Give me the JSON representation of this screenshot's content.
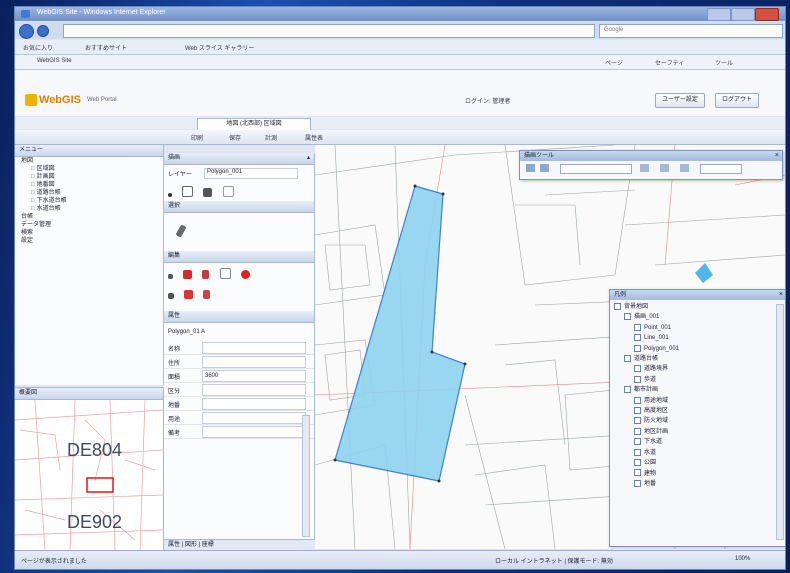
{
  "browser": {
    "title": "WebGIS Site - Windows Internet Explorer",
    "search_placeholder": "Google"
  },
  "favorites": [
    "お気に入り",
    "おすすめサイト",
    "Web スライス ギャラリー"
  ],
  "command": [
    "ページ",
    "セーフティ",
    "ツール"
  ],
  "tab_label": "WebGIS Site",
  "app": {
    "logo": "WebGIS",
    "logo_sub": "Web Portal",
    "user_info": "ログイン: 管理者",
    "buttons": [
      "ユーザー設定",
      "ログアウト"
    ]
  },
  "map_tab": "地図 (北西部) 区域図",
  "toolbar": [
    "印刷",
    "保存",
    "計測",
    "属性表"
  ],
  "left_nav": {
    "header": "メニュー",
    "group1": "地図",
    "items": [
      "区域図",
      "計画図",
      "地番図",
      "道路台帳",
      "下水道台帳",
      "水道台帳"
    ],
    "group2": "台帳",
    "group3": "データ管理",
    "group4": "検索",
    "group5": "設定"
  },
  "overview": {
    "title": "概要図",
    "labels": [
      "DE804",
      "DE902"
    ]
  },
  "tool_panel": {
    "title": "描画",
    "layer_label": "レイヤー",
    "layer_value": "Polygon_001",
    "sec_select": "選択",
    "sec_edit": "編集",
    "sec_attr": "属性",
    "feature_id": "Polygon_01 A",
    "attr_fields": [
      {
        "k": "名称",
        "v": ""
      },
      {
        "k": "住所",
        "v": ""
      },
      {
        "k": "面積",
        "v": "3600"
      },
      {
        "k": "区分",
        "v": ""
      },
      {
        "k": "地番",
        "v": ""
      },
      {
        "k": "用途",
        "v": ""
      },
      {
        "k": "備考",
        "v": ""
      }
    ],
    "bottom_tab": "属性 | 図形 | 座標"
  },
  "float_toolbar": {
    "title": "描画ツール"
  },
  "layers": {
    "title": "凡例",
    "items": [
      {
        "label": "背景地図",
        "indent": 0
      },
      {
        "label": "描画_001",
        "indent": 1
      },
      {
        "label": "Point_001",
        "indent": 2
      },
      {
        "label": "Line_001",
        "indent": 2
      },
      {
        "label": "Polygon_001",
        "indent": 2
      },
      {
        "label": "道路台帳",
        "indent": 1
      },
      {
        "label": "道路境界",
        "indent": 2
      },
      {
        "label": "歩道",
        "indent": 2
      },
      {
        "label": "都市計画",
        "indent": 1
      },
      {
        "label": "用途地域",
        "indent": 2
      },
      {
        "label": "高度地区",
        "indent": 2
      },
      {
        "label": "防火地域",
        "indent": 2
      },
      {
        "label": "地区計画",
        "indent": 2
      },
      {
        "label": "下水道",
        "indent": 2
      },
      {
        "label": "水道",
        "indent": 2
      },
      {
        "label": "公園",
        "indent": 2
      },
      {
        "label": "建物",
        "indent": 2
      },
      {
        "label": "地番",
        "indent": 2
      }
    ]
  },
  "status": {
    "left": "ページが表示されました",
    "mid": "ローカル イントラネット | 保護モード: 無効",
    "zoom": "100%"
  },
  "colors": {
    "polygon_fill": "#8fd3ee",
    "polygon_stroke": "#2a74c8",
    "accent": "#f0b400"
  }
}
